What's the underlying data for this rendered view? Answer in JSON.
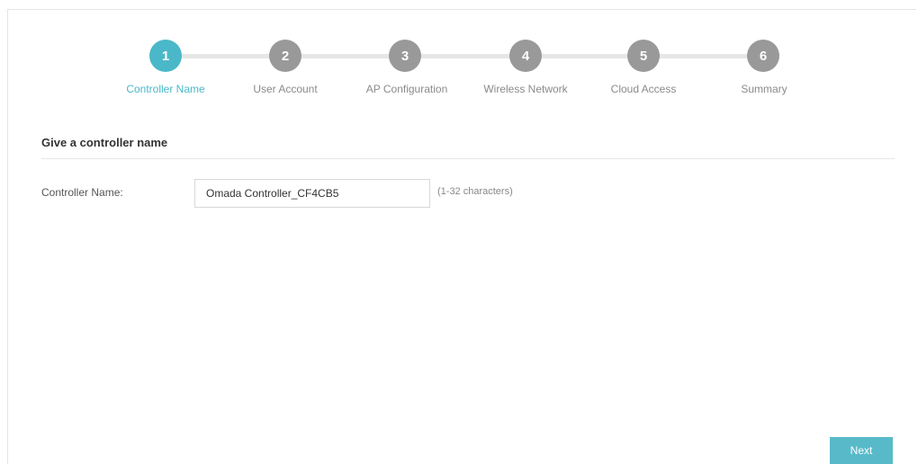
{
  "wizard": {
    "steps": [
      {
        "number": "1",
        "label": "Controller Name",
        "active": true
      },
      {
        "number": "2",
        "label": "User Account",
        "active": false
      },
      {
        "number": "3",
        "label": "AP Configuration",
        "active": false
      },
      {
        "number": "4",
        "label": "Wireless Network",
        "active": false
      },
      {
        "number": "5",
        "label": "Cloud Access",
        "active": false
      },
      {
        "number": "6",
        "label": "Summary",
        "active": false
      }
    ],
    "active_color": "#4ab8c8",
    "inactive_color": "#999999"
  },
  "form": {
    "section_title": "Give a controller name",
    "controller_name_label": "Controller Name:",
    "controller_name_value": "Omada Controller_CF4CB5",
    "controller_name_hint": "(1-32 characters)"
  },
  "footer": {
    "next_label": "Next"
  }
}
